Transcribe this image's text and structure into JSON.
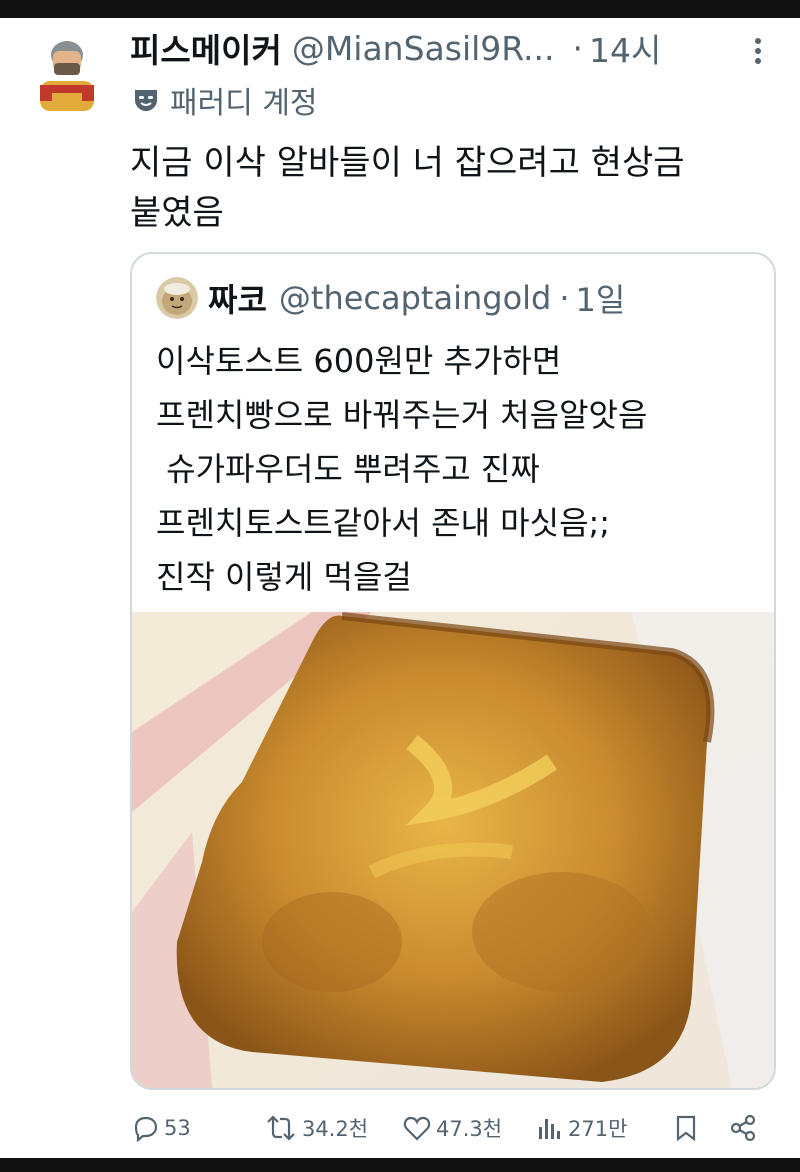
{
  "tweet": {
    "display_name": "피스메이커",
    "handle": "@MianSasil9R...",
    "separator": "·",
    "time": "14시",
    "parody_label": "패러디 계정",
    "text_lines": [
      "지금 이삭 알바들이 너 잡으려고 현상금",
      "붙였음"
    ]
  },
  "quote": {
    "display_name": "짜코",
    "handle": "@thecaptaingold",
    "separator": "·",
    "time": "1일",
    "text": "이삭토스트 600원만 추가하면\n프렌치빵으로 바꿔주는거 처음알앗음\n 슈가파우더도 뿌려주고 진짜\n프렌치토스트같아서 존내 마싯음;;\n진작 이렇게 먹을걸"
  },
  "actions": {
    "replies": "53",
    "retweets": "34.2천",
    "likes": "47.3천",
    "views": "271만"
  },
  "icons": {
    "avatar": "peacemaker-avatar-icon",
    "quote_avatar": "potato-avatar-icon",
    "parody": "mask-icon",
    "more": "more-vertical-icon",
    "reply": "reply-icon",
    "retweet": "retweet-icon",
    "like": "heart-icon",
    "views": "views-icon",
    "bookmark": "bookmark-icon",
    "share": "share-icon"
  },
  "colors": {
    "text_primary": "#0f1419",
    "text_secondary": "#536471",
    "border": "#cfd9de"
  }
}
